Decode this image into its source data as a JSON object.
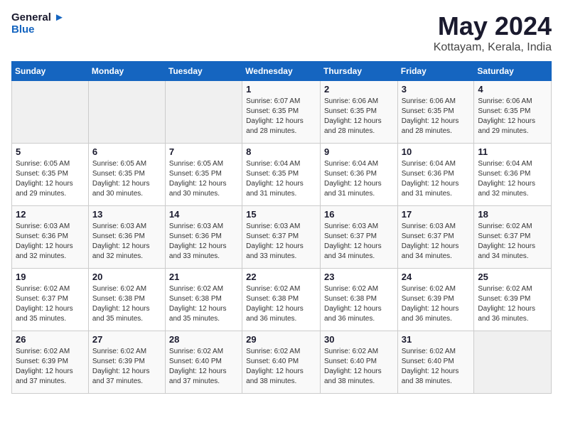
{
  "logo": {
    "line1": "General",
    "line2": "Blue"
  },
  "title": "May 2024",
  "subtitle": "Kottayam, Kerala, India",
  "headers": [
    "Sunday",
    "Monday",
    "Tuesday",
    "Wednesday",
    "Thursday",
    "Friday",
    "Saturday"
  ],
  "weeks": [
    [
      {
        "day": "",
        "info": ""
      },
      {
        "day": "",
        "info": ""
      },
      {
        "day": "",
        "info": ""
      },
      {
        "day": "1",
        "info": "Sunrise: 6:07 AM\nSunset: 6:35 PM\nDaylight: 12 hours\nand 28 minutes."
      },
      {
        "day": "2",
        "info": "Sunrise: 6:06 AM\nSunset: 6:35 PM\nDaylight: 12 hours\nand 28 minutes."
      },
      {
        "day": "3",
        "info": "Sunrise: 6:06 AM\nSunset: 6:35 PM\nDaylight: 12 hours\nand 28 minutes."
      },
      {
        "day": "4",
        "info": "Sunrise: 6:06 AM\nSunset: 6:35 PM\nDaylight: 12 hours\nand 29 minutes."
      }
    ],
    [
      {
        "day": "5",
        "info": "Sunrise: 6:05 AM\nSunset: 6:35 PM\nDaylight: 12 hours\nand 29 minutes."
      },
      {
        "day": "6",
        "info": "Sunrise: 6:05 AM\nSunset: 6:35 PM\nDaylight: 12 hours\nand 30 minutes."
      },
      {
        "day": "7",
        "info": "Sunrise: 6:05 AM\nSunset: 6:35 PM\nDaylight: 12 hours\nand 30 minutes."
      },
      {
        "day": "8",
        "info": "Sunrise: 6:04 AM\nSunset: 6:35 PM\nDaylight: 12 hours\nand 31 minutes."
      },
      {
        "day": "9",
        "info": "Sunrise: 6:04 AM\nSunset: 6:36 PM\nDaylight: 12 hours\nand 31 minutes."
      },
      {
        "day": "10",
        "info": "Sunrise: 6:04 AM\nSunset: 6:36 PM\nDaylight: 12 hours\nand 31 minutes."
      },
      {
        "day": "11",
        "info": "Sunrise: 6:04 AM\nSunset: 6:36 PM\nDaylight: 12 hours\nand 32 minutes."
      }
    ],
    [
      {
        "day": "12",
        "info": "Sunrise: 6:03 AM\nSunset: 6:36 PM\nDaylight: 12 hours\nand 32 minutes."
      },
      {
        "day": "13",
        "info": "Sunrise: 6:03 AM\nSunset: 6:36 PM\nDaylight: 12 hours\nand 32 minutes."
      },
      {
        "day": "14",
        "info": "Sunrise: 6:03 AM\nSunset: 6:36 PM\nDaylight: 12 hours\nand 33 minutes."
      },
      {
        "day": "15",
        "info": "Sunrise: 6:03 AM\nSunset: 6:37 PM\nDaylight: 12 hours\nand 33 minutes."
      },
      {
        "day": "16",
        "info": "Sunrise: 6:03 AM\nSunset: 6:37 PM\nDaylight: 12 hours\nand 34 minutes."
      },
      {
        "day": "17",
        "info": "Sunrise: 6:03 AM\nSunset: 6:37 PM\nDaylight: 12 hours\nand 34 minutes."
      },
      {
        "day": "18",
        "info": "Sunrise: 6:02 AM\nSunset: 6:37 PM\nDaylight: 12 hours\nand 34 minutes."
      }
    ],
    [
      {
        "day": "19",
        "info": "Sunrise: 6:02 AM\nSunset: 6:37 PM\nDaylight: 12 hours\nand 35 minutes."
      },
      {
        "day": "20",
        "info": "Sunrise: 6:02 AM\nSunset: 6:38 PM\nDaylight: 12 hours\nand 35 minutes."
      },
      {
        "day": "21",
        "info": "Sunrise: 6:02 AM\nSunset: 6:38 PM\nDaylight: 12 hours\nand 35 minutes."
      },
      {
        "day": "22",
        "info": "Sunrise: 6:02 AM\nSunset: 6:38 PM\nDaylight: 12 hours\nand 36 minutes."
      },
      {
        "day": "23",
        "info": "Sunrise: 6:02 AM\nSunset: 6:38 PM\nDaylight: 12 hours\nand 36 minutes."
      },
      {
        "day": "24",
        "info": "Sunrise: 6:02 AM\nSunset: 6:39 PM\nDaylight: 12 hours\nand 36 minutes."
      },
      {
        "day": "25",
        "info": "Sunrise: 6:02 AM\nSunset: 6:39 PM\nDaylight: 12 hours\nand 36 minutes."
      }
    ],
    [
      {
        "day": "26",
        "info": "Sunrise: 6:02 AM\nSunset: 6:39 PM\nDaylight: 12 hours\nand 37 minutes."
      },
      {
        "day": "27",
        "info": "Sunrise: 6:02 AM\nSunset: 6:39 PM\nDaylight: 12 hours\nand 37 minutes."
      },
      {
        "day": "28",
        "info": "Sunrise: 6:02 AM\nSunset: 6:40 PM\nDaylight: 12 hours\nand 37 minutes."
      },
      {
        "day": "29",
        "info": "Sunrise: 6:02 AM\nSunset: 6:40 PM\nDaylight: 12 hours\nand 38 minutes."
      },
      {
        "day": "30",
        "info": "Sunrise: 6:02 AM\nSunset: 6:40 PM\nDaylight: 12 hours\nand 38 minutes."
      },
      {
        "day": "31",
        "info": "Sunrise: 6:02 AM\nSunset: 6:40 PM\nDaylight: 12 hours\nand 38 minutes."
      },
      {
        "day": "",
        "info": ""
      }
    ]
  ]
}
